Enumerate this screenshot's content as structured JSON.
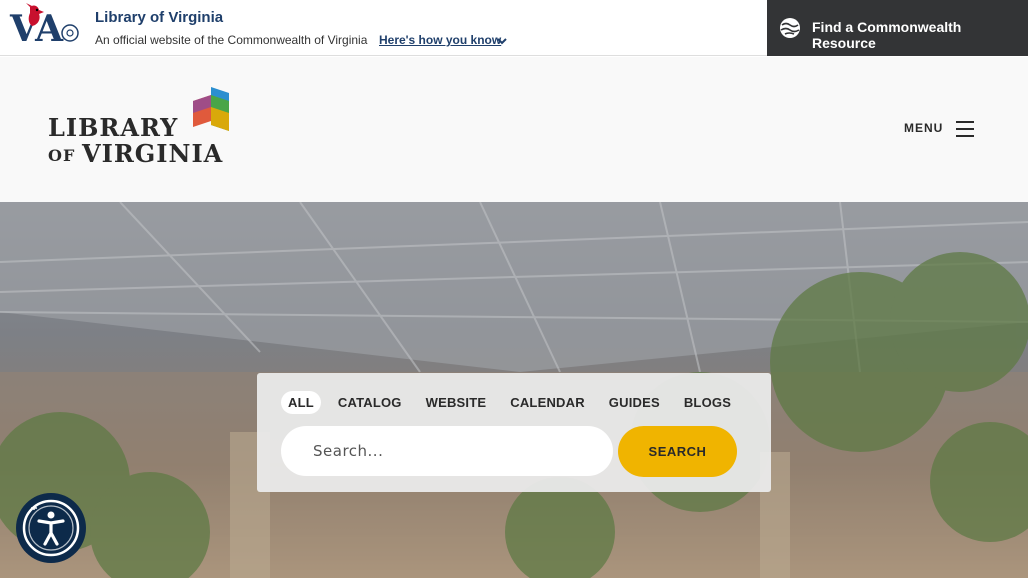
{
  "topbar": {
    "title": "Library of Virginia",
    "subtitle": "An official website of the Commonwealth of Virginia",
    "how_link": "Here's how you know",
    "find_resource": "Find a Commonwealth Resource",
    "logo_text": "VA"
  },
  "header": {
    "logo_line1": "LIBRARY",
    "logo_of": "OF",
    "logo_line2": "VIRGINIA",
    "menu_label": "MENU"
  },
  "search": {
    "tabs": [
      "ALL",
      "CATALOG",
      "WEBSITE",
      "CALENDAR",
      "GUIDES",
      "BLOGS"
    ],
    "active_tab": "ALL",
    "placeholder": "Search...",
    "button_label": "SEARCH"
  },
  "colors": {
    "accent": "#f0b400",
    "navy": "#1f3f6b",
    "dark_bar": "#333436"
  },
  "icons": {
    "va_logo": "virginia-cardinal-logo",
    "chevron": "chevron-down-icon",
    "globe": "globe-icon",
    "book": "library-book-icon",
    "hamburger": "hamburger-icon",
    "accessibility": "accessibility-icon"
  }
}
